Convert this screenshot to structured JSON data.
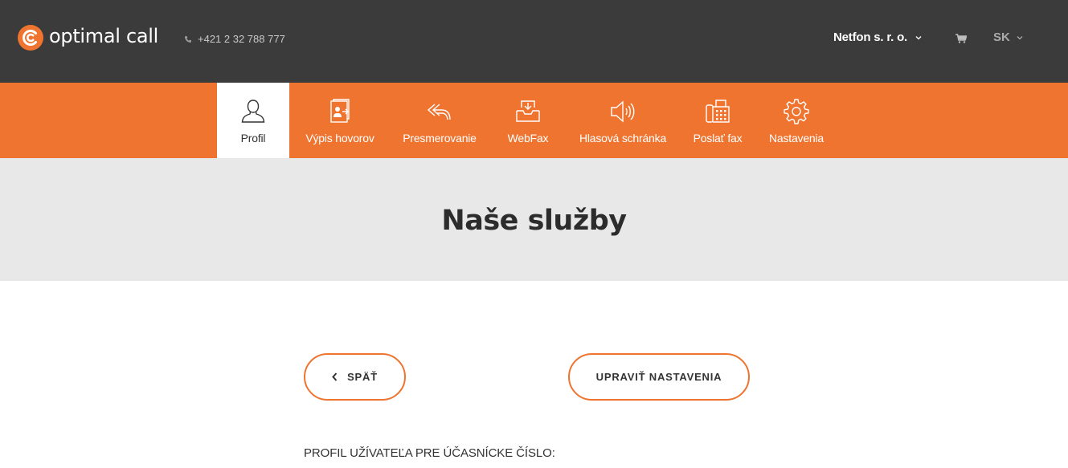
{
  "header": {
    "logo_text": "optimal call",
    "logo_icon": "optimal-call-logo",
    "phone": "+421 2 32 788 777",
    "phone_icon": "phone-icon",
    "company": "Netfon s. r. o.",
    "cart_icon": "cart-icon",
    "language": "SK",
    "background_color": "#3b3b3b"
  },
  "nav": {
    "accent_color": "#ee7430",
    "items": [
      {
        "label": "Profil",
        "icon": "user-icon",
        "active": true
      },
      {
        "label": "Výpis hovorov",
        "icon": "call-log-icon",
        "active": false
      },
      {
        "label": "Presmerovanie",
        "icon": "forward-icon",
        "active": false
      },
      {
        "label": "WebFax",
        "icon": "inbox-icon",
        "active": false
      },
      {
        "label": "Hlasová schránka",
        "icon": "speaker-icon",
        "active": false
      },
      {
        "label": "Poslať fax",
        "icon": "fax-icon",
        "active": false
      },
      {
        "label": "Nastavenia",
        "icon": "gear-icon",
        "active": false
      }
    ]
  },
  "hero": {
    "title": "Naše služby"
  },
  "actions": {
    "back_label": "SPÄŤ",
    "edit_label": "UPRAVIŤ NASTAVENIA"
  },
  "content": {
    "profile_label": "PROFIL UŽÍVATEĽA PRE ÚČASNÍCKE ČÍSLO:"
  }
}
